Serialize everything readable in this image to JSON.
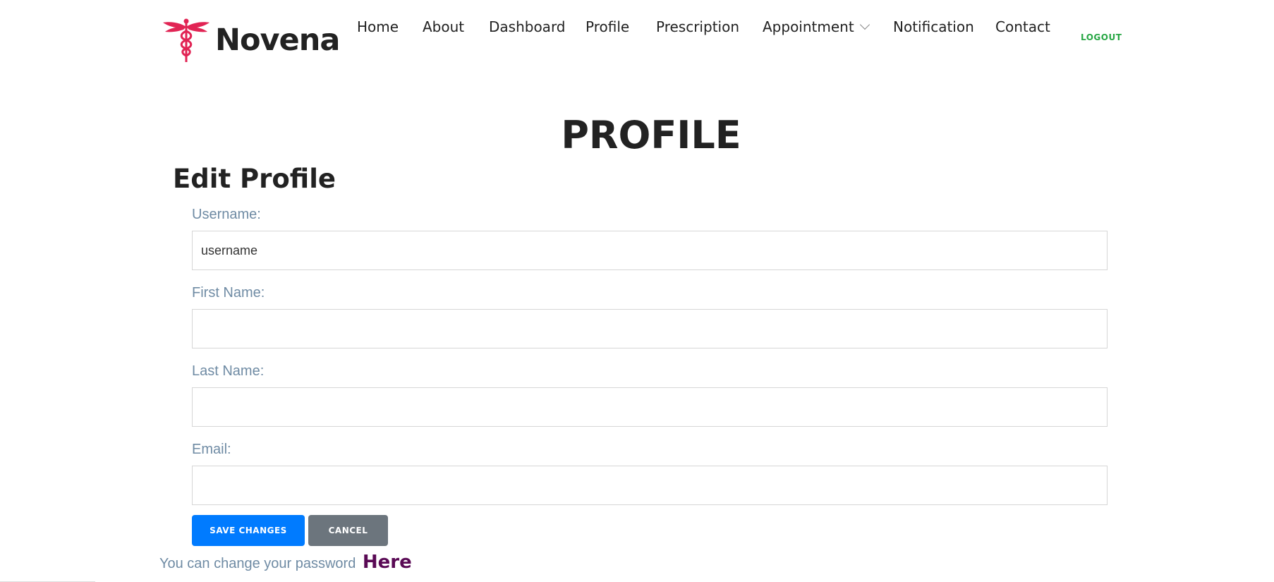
{
  "brand": {
    "name": "Novena",
    "logo_icon": "caduceus-icon",
    "logo_color": "#e12454"
  },
  "nav": {
    "items": [
      {
        "label": "Home"
      },
      {
        "label": "About"
      },
      {
        "label": "Dashboard"
      },
      {
        "label": "Profile"
      },
      {
        "label": "Prescription"
      },
      {
        "label": "Appointment",
        "icon": "chevron-down-icon"
      },
      {
        "label": "Notification"
      },
      {
        "label": "Contact"
      }
    ],
    "logout_label": "LOGOUT",
    "logout_color": "#28a745"
  },
  "page": {
    "title": "PROFILE",
    "section_title": "Edit Profile"
  },
  "form": {
    "username": {
      "label": "Username:",
      "value": "username"
    },
    "first_name": {
      "label": "First Name:",
      "value": ""
    },
    "last_name": {
      "label": "Last Name:",
      "value": ""
    },
    "email": {
      "label": "Email:",
      "value": ""
    },
    "save_label": "SAVE CHANGES",
    "cancel_label": "CANCEL",
    "save_color": "#007bff",
    "cancel_color": "#6c757d"
  },
  "footer": {
    "password_text": "You can change your password",
    "password_link": "Here"
  }
}
